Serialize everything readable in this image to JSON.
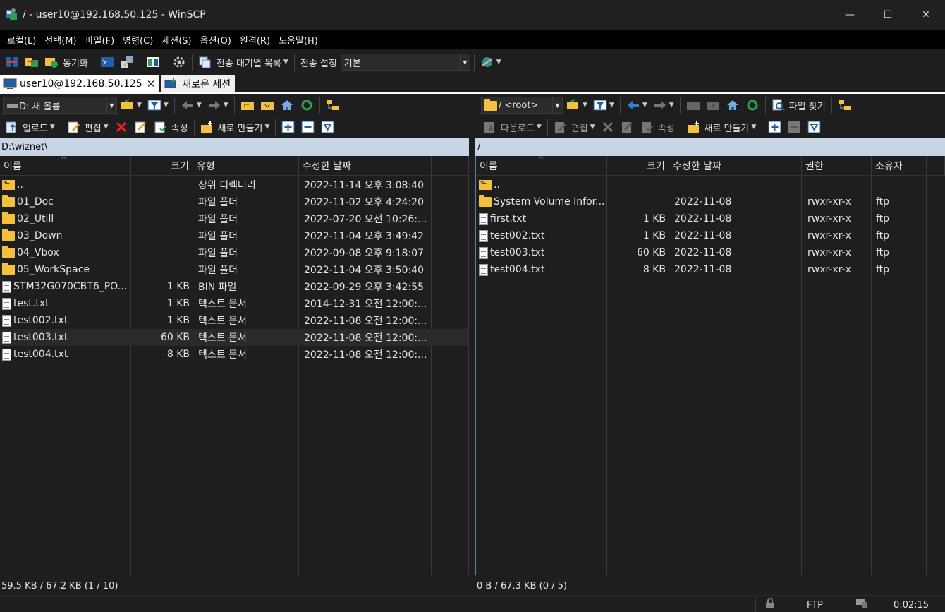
{
  "window": {
    "title": "/ - user10@192.168.50.125 - WinSCP",
    "minimize": "—",
    "maximize": "☐",
    "close": "✕"
  },
  "menu": [
    "로컬(L)",
    "선택(M)",
    "파일(F)",
    "명령(C)",
    "세션(S)",
    "옵션(O)",
    "원격(R)",
    "도움말(H)"
  ],
  "toolbar": {
    "sync_label": "동기화",
    "queue_label": "전송 대기열 목록",
    "transfer_settings_label": "전송 설정",
    "transfer_preset": "기본"
  },
  "tabs": {
    "session_label": "user10@192.168.50.125",
    "new_session_label": "새로운 세션"
  },
  "left": {
    "drive": "D: 새 볼륨",
    "path": "D:\\wiznet\\",
    "toolbar": {
      "upload": "업로드",
      "edit": "편집",
      "properties": "속성",
      "new": "새로 만들기"
    },
    "columns": [
      "이름",
      "크기",
      "유형",
      "수정한 날짜"
    ],
    "rows": [
      {
        "icon": "parent-dir",
        "name": "..",
        "size": "",
        "type": "상위 디렉터리",
        "date": "2022-11-14  오후 3:08:40"
      },
      {
        "icon": "folder",
        "name": "01_Doc",
        "size": "",
        "type": "파일 폴더",
        "date": "2022-11-02  오후 4:24:20"
      },
      {
        "icon": "folder",
        "name": "02_Utill",
        "size": "",
        "type": "파일 폴더",
        "date": "2022-07-20  오전 10:26:..."
      },
      {
        "icon": "folder",
        "name": "03_Down",
        "size": "",
        "type": "파일 폴더",
        "date": "2022-11-04  오후 3:49:42"
      },
      {
        "icon": "folder",
        "name": "04_Vbox",
        "size": "",
        "type": "파일 폴더",
        "date": "2022-09-08  오후 9:18:07"
      },
      {
        "icon": "folder",
        "name": "05_WorkSpace",
        "size": "",
        "type": "파일 폴더",
        "date": "2022-11-04  오후 3:50:40"
      },
      {
        "icon": "file",
        "name": "STM32G070CBT6_PO...",
        "size": "1 KB",
        "type": "BIN 파일",
        "date": "2022-09-29  오후 3:42:55"
      },
      {
        "icon": "file",
        "name": "test.txt",
        "size": "1 KB",
        "type": "텍스트 문서",
        "date": "2014-12-31  오전 12:00:..."
      },
      {
        "icon": "file",
        "name": "test002.txt",
        "size": "1 KB",
        "type": "텍스트 문서",
        "date": "2022-11-08  오전 12:00:..."
      },
      {
        "icon": "file",
        "name": "test003.txt",
        "size": "60 KB",
        "type": "텍스트 문서",
        "date": "2022-11-08  오전 12:00:..."
      },
      {
        "icon": "file",
        "name": "test004.txt",
        "size": "8 KB",
        "type": "텍스트 문서",
        "date": "2022-11-08  오전 12:00:..."
      }
    ],
    "status": "59.5 KB / 67.2 KB (1 / 10)"
  },
  "right": {
    "drive": "/ <root>",
    "path": "/",
    "toolbar": {
      "download": "다운로드",
      "edit": "편집",
      "properties": "속성",
      "new": "새로 만들기",
      "find": "파일 찾기"
    },
    "columns": [
      "이름",
      "크기",
      "수정한 날짜",
      "권한",
      "소유자"
    ],
    "rows": [
      {
        "icon": "parent-dir",
        "name": "..",
        "size": "",
        "date": "",
        "rights": "",
        "owner": ""
      },
      {
        "icon": "folder",
        "name": "System Volume Infor...",
        "size": "",
        "date": "2022-11-08",
        "rights": "rwxr-xr-x",
        "owner": "ftp"
      },
      {
        "icon": "file",
        "name": "first.txt",
        "size": "1 KB",
        "date": "2022-11-08",
        "rights": "rwxr-xr-x",
        "owner": "ftp"
      },
      {
        "icon": "file",
        "name": "test002.txt",
        "size": "1 KB",
        "date": "2022-11-08",
        "rights": "rwxr-xr-x",
        "owner": "ftp"
      },
      {
        "icon": "file",
        "name": "test003.txt",
        "size": "60 KB",
        "date": "2022-11-08",
        "rights": "rwxr-xr-x",
        "owner": "ftp"
      },
      {
        "icon": "file",
        "name": "test004.txt",
        "size": "8 KB",
        "date": "2022-11-08",
        "rights": "rwxr-xr-x",
        "owner": "ftp"
      }
    ],
    "status": "0 B / 67.3 KB (0 / 5)"
  },
  "statusbar": {
    "protocol": "FTP",
    "elapsed": "0:02:15"
  },
  "colors": {
    "accent_path": "#c7d5e5",
    "folder": "#f3c13a",
    "background": "#1e1e1e"
  }
}
